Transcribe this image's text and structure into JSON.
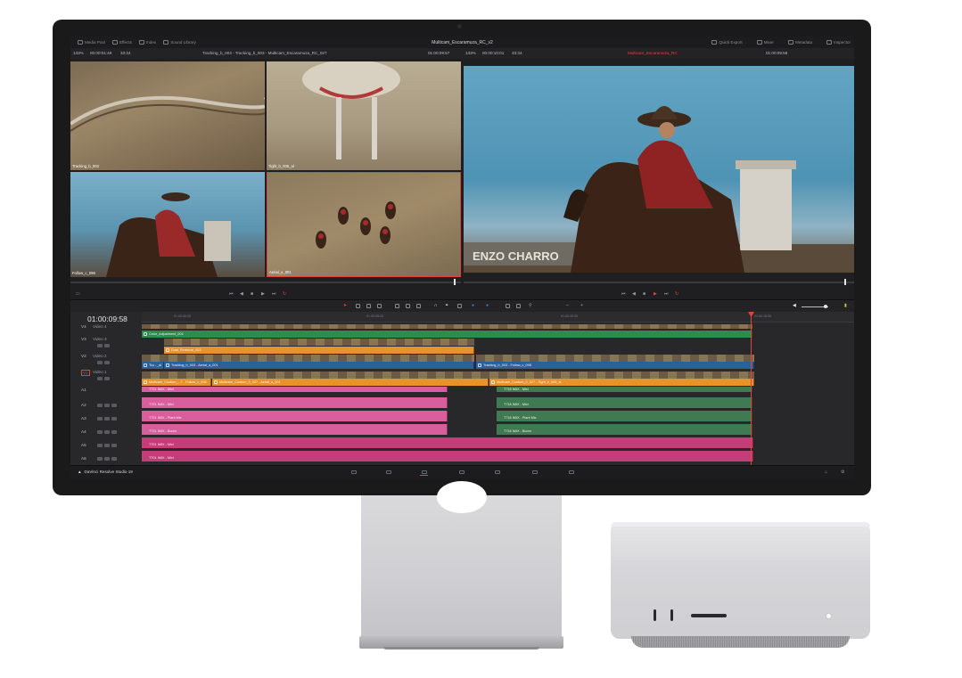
{
  "app": {
    "window_title": "Multicam_Escaramuza_RC_v2",
    "brand": "DaVinci Resolve Studio 19"
  },
  "menubar": {
    "left_items": [
      "Media Pool",
      "Effects",
      "Index",
      "Sound Library"
    ],
    "right_items": [
      "Quick Export",
      "Mixer",
      "Metadata",
      "Inspector"
    ]
  },
  "timecode_bar": {
    "zoom_left": "133%",
    "source_tc": "00:00:01:49",
    "source_dur": "33:34",
    "clip_title": "Tracking_b_003 - Tracking_b_003 - Multicam_Escaramuza_RC_027",
    "record_tc_a": "01:00:09:57",
    "zoom_right": "133%",
    "program_tc": "00:00:10:01",
    "program_dur": "33:34",
    "timeline_name": "Multicam_Escaramuza_RC",
    "record_tc_b": "01:00:09:58"
  },
  "viewers": [
    {
      "label": "Tracking_b_003"
    },
    {
      "label": "Tight_b_005_al"
    },
    {
      "label": "Follow_c_098"
    },
    {
      "label": "Aerial_a_001"
    }
  ],
  "timeline": {
    "timecode": "01:00:09:58",
    "ruler_ticks": [
      "01:00:00:00",
      "01:00:05:00",
      "01:00:10:00",
      "01:00:15:00"
    ],
    "tracks": [
      {
        "id": "V4",
        "name": "Video 4"
      },
      {
        "id": "V3",
        "name": "Video 3"
      },
      {
        "id": "V2",
        "name": "Video 2"
      },
      {
        "id": "V1",
        "name": "Video 1"
      },
      {
        "id": "A1",
        "name": ""
      },
      {
        "id": "A2",
        "name": ""
      },
      {
        "id": "A3",
        "name": ""
      },
      {
        "id": "A4",
        "name": ""
      },
      {
        "id": "A5",
        "name": ""
      },
      {
        "id": "A6",
        "name": ""
      }
    ],
    "clips": {
      "color_adj": "Color_Adjustment_004",
      "dust_removal": "Dust_Removal_003",
      "v2_a": "Tra..._al",
      "v2_b": "Tracking_b_003 - Aerial_a_001",
      "v2_c": "Tracking_b_003 - Follow_c_098",
      "v1_a": "Multicam_Custom_...7 - Follow_c_098",
      "v1_b": "Multicam_Custom_0_027 - Aerial_a_001",
      "v1_c": "Multicam_Custom_0_027 - Tight_b_005_al",
      "a1_a": "T721 IMIX - Mixl",
      "a1_b": "T718 IMIX - Mixl",
      "a2_a": "T721 IMIX - Mixl",
      "a2_b": "T718 IMIX - Mixl",
      "a3_a": "T721 IMIX - Plant Mic",
      "a3_b": "T718 IMIX - Plant Mic",
      "a4_a": "T721 IMIX - Boom",
      "a4_b": "T718 IMIX - Boom",
      "a5": "T701 IMIX - Mixl",
      "a6": "T701 IMIX - Mixl"
    }
  },
  "colors": {
    "accent": "#e0453a",
    "video_clip_green": "#2f8a4d",
    "video_clip_orange": "#e6932e",
    "video_clip_blue": "#2f5f9a",
    "audio_pink": "#d85f9b",
    "audio_magenta": "#c43d78"
  }
}
